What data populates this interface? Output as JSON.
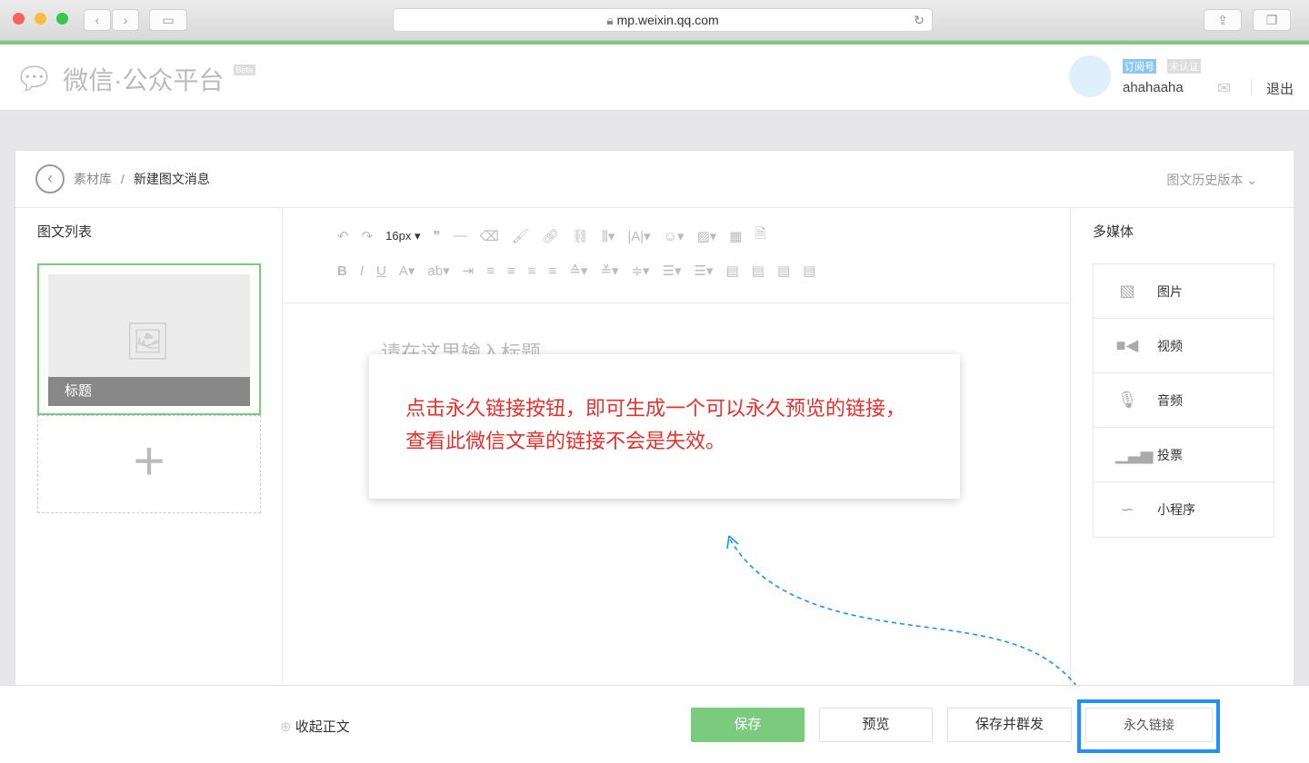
{
  "browser": {
    "url": "mp.weixin.qq.com",
    "back": "‹",
    "forward": "›"
  },
  "header": {
    "logo_text": "微信·公众平台",
    "beta": "Beta",
    "account_type": "订阅号",
    "verify": "未认证",
    "username": "ahahaaha",
    "logout": "退出"
  },
  "breadcrumb": {
    "parent": "素材库",
    "separator": "/",
    "current": "新建图文消息",
    "history": "图文历史版本"
  },
  "left": {
    "title": "图文列表",
    "item_title": "标题",
    "add": "+"
  },
  "toolbar": {
    "font_size": "16px"
  },
  "editor": {
    "title_placeholder": "请在这里输入标题"
  },
  "right": {
    "title": "多媒体",
    "items": [
      {
        "label": "图片",
        "icon": "image-icon"
      },
      {
        "label": "视频",
        "icon": "video-icon"
      },
      {
        "label": "音频",
        "icon": "microphone-icon"
      },
      {
        "label": "投票",
        "icon": "vote-icon"
      },
      {
        "label": "小程序",
        "icon": "mini-program-icon"
      }
    ]
  },
  "bottom": {
    "collapse": "收起正文",
    "save": "保存",
    "preview": "预览",
    "save_send": "保存并群发",
    "permalink": "永久链接"
  },
  "annotation": {
    "text": "点击永久链接按钮，即可生成一个可以永久预览的链接，查看此微信文章的链接不会是失效。"
  },
  "colors": {
    "accent": "#7bcb7f",
    "highlight": "#1e90ff",
    "annotation": "#e5302c"
  }
}
